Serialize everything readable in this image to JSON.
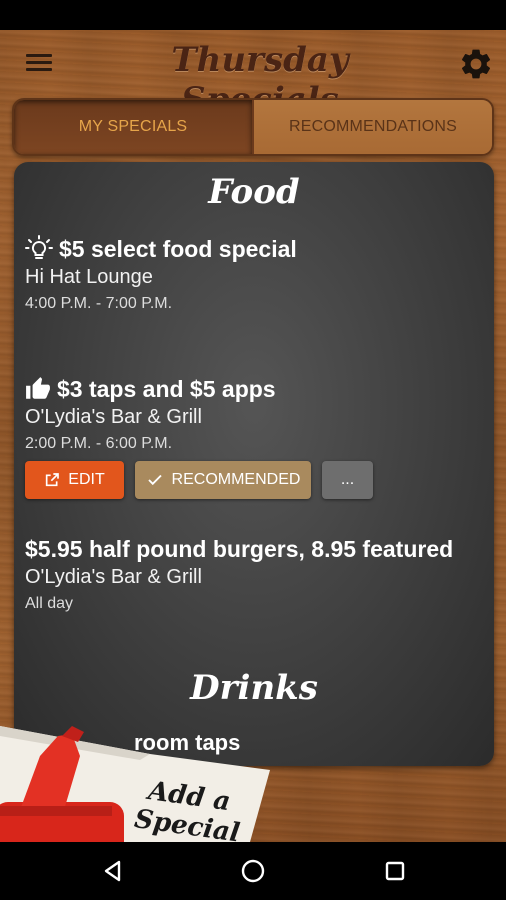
{
  "app": {
    "title": "Thursday Specials"
  },
  "tabs": [
    {
      "label": "MY SPECIALS",
      "active": true
    },
    {
      "label": "RECOMMENDATIONS",
      "active": false
    }
  ],
  "sections": {
    "food": {
      "title": "Food"
    },
    "drinks": {
      "title": "Drinks"
    }
  },
  "specials": [
    {
      "icon": "lightbulb-icon",
      "title": "$5 select food special",
      "venue": "Hi Hat Lounge",
      "time": "4:00 P.M. - 7:00 P.M."
    },
    {
      "icon": "thumbs-up-icon",
      "title": "$3 taps and $5 apps",
      "venue": "O'Lydia's Bar & Grill",
      "time": "2:00 P.M. - 6:00 P.M."
    },
    {
      "icon": "",
      "title": "$5.95 half pound burgers, 8.95 featured",
      "venue": "O'Lydia's Bar & Grill",
      "time": "All day"
    }
  ],
  "actions": {
    "edit_label": "EDIT",
    "recommended_label": "RECOMMENDED",
    "more_label": "..."
  },
  "drinks_partial_item": "room taps",
  "add_special": {
    "line1": "Add a",
    "line2": "Special"
  },
  "colors": {
    "edit": "#e2561c",
    "recommended": "#a98a5e",
    "more": "#6e6e6e",
    "tab_active_text": "#e6a54a"
  }
}
